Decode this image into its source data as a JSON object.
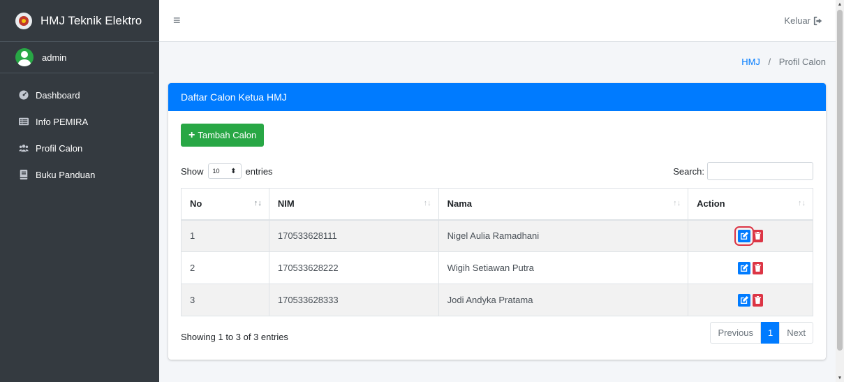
{
  "brand": {
    "title": "HMJ Teknik Elektro"
  },
  "user": {
    "name": "admin"
  },
  "sidebar": {
    "items": [
      {
        "label": "Dashboard",
        "icon": "dashboard-icon"
      },
      {
        "label": "Info PEMIRA",
        "icon": "list-icon"
      },
      {
        "label": "Profil Calon",
        "icon": "users-icon"
      },
      {
        "label": "Buku Panduan",
        "icon": "book-icon"
      }
    ]
  },
  "topbar": {
    "menu_icon": "≡",
    "logout_label": "Keluar"
  },
  "breadcrumb": {
    "home": "HMJ",
    "separator": "/",
    "current": "Profil Calon"
  },
  "card": {
    "title": "Daftar Calon Ketua HMJ",
    "add_button": "Tambah Calon",
    "show_label": "Show",
    "entries_value": "10",
    "entries_label": "entries",
    "search_label": "Search:",
    "search_value": ""
  },
  "table": {
    "columns": [
      "No",
      "NIM",
      "Nama",
      "Action"
    ],
    "rows": [
      {
        "no": "1",
        "nim": "170533628111",
        "nama": "Nigel Aulia Ramadhani"
      },
      {
        "no": "2",
        "nim": "170533628222",
        "nama": "Wigih Setiawan Putra"
      },
      {
        "no": "3",
        "nim": "170533628333",
        "nama": "Jodi Andyka Pratama"
      }
    ]
  },
  "footer": {
    "info": "Showing 1 to 3 of 3 entries",
    "prev": "Previous",
    "page": "1",
    "next": "Next"
  },
  "colors": {
    "primary": "#007bff",
    "success": "#28a745",
    "danger": "#dc3545",
    "sidebar": "#343a40"
  }
}
